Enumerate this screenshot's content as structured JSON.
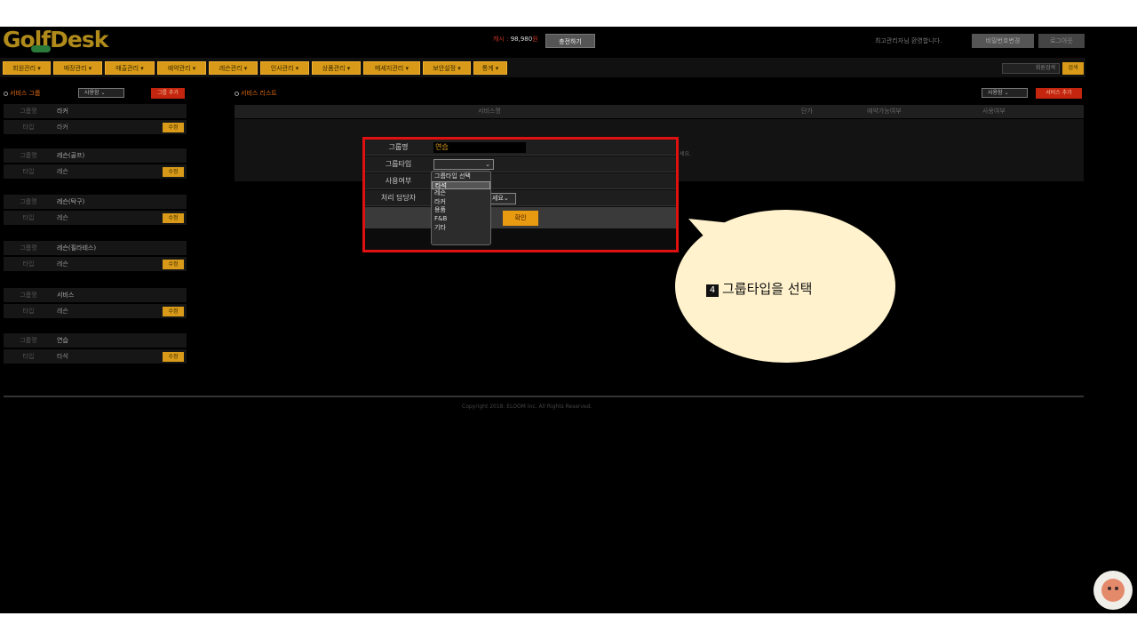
{
  "header": {
    "logo": "GolfDesk",
    "cash_label": "캐시 : ",
    "cash_amount": "98,980",
    "cash_unit": "원",
    "charge_button": "충전하기",
    "welcome_text": "최고관리자님 환영합니다.",
    "password_button": "비밀번호변경",
    "logout_button": "로그아웃"
  },
  "nav": {
    "items": [
      "회원관리 ▾",
      "매장관리 ▾",
      "매출관리 ▾",
      "예약관리 ▾",
      "레슨관리 ▾",
      "인사관리 ▾",
      "상품관리 ▾",
      "메세지관리 ▾",
      "보안설정 ▾",
      "통계 ▾"
    ],
    "member_search_placeholder": "회원검색",
    "search_button": "검색"
  },
  "left_panel": {
    "title": "서비스 그룹",
    "filter_value": "사용함",
    "add_button": "그룹 추가",
    "label_group": "그룹명",
    "label_type": "타입",
    "edit_button": "수정",
    "groups": [
      {
        "name": "라커",
        "type": "라커"
      },
      {
        "name": "레슨(골프)",
        "type": "레슨"
      },
      {
        "name": "레슨(탁구)",
        "type": "레슨"
      },
      {
        "name": "레슨(필라테스)",
        "type": "레슨"
      },
      {
        "name": "서비스",
        "type": "레슨"
      },
      {
        "name": "연습",
        "type": "타석"
      }
    ]
  },
  "right_panel": {
    "title": "서비스 리스트",
    "filter_value": "사용함",
    "add_button": "서비스 추가",
    "columns": [
      "서비스명",
      "단가",
      "예약가능여부",
      "사용여부"
    ],
    "empty_message_tail": "세요."
  },
  "modal": {
    "label_name": "그룹명",
    "name_value": "연습",
    "label_type": "그룹타입",
    "label_use": "사용여부",
    "label_manager": "처리 담당자",
    "manager_select_value": "세요",
    "confirm_button": "확인",
    "type_options": [
      "그룹타입 선택",
      "타석",
      "레슨",
      "라커",
      "용품",
      "F&B",
      "기타"
    ],
    "highlighted_option": "타석"
  },
  "callout": {
    "step_number": "4",
    "text": "그룹타입을 선택"
  },
  "footer": {
    "copyright": "Copyright 2018. ELOOM Inc. All Rights Reserved."
  },
  "colors": {
    "accent": "#d89a18",
    "danger": "#c4250e",
    "highlight_border": "#e01010",
    "callout_fill": "#fff2cc"
  }
}
